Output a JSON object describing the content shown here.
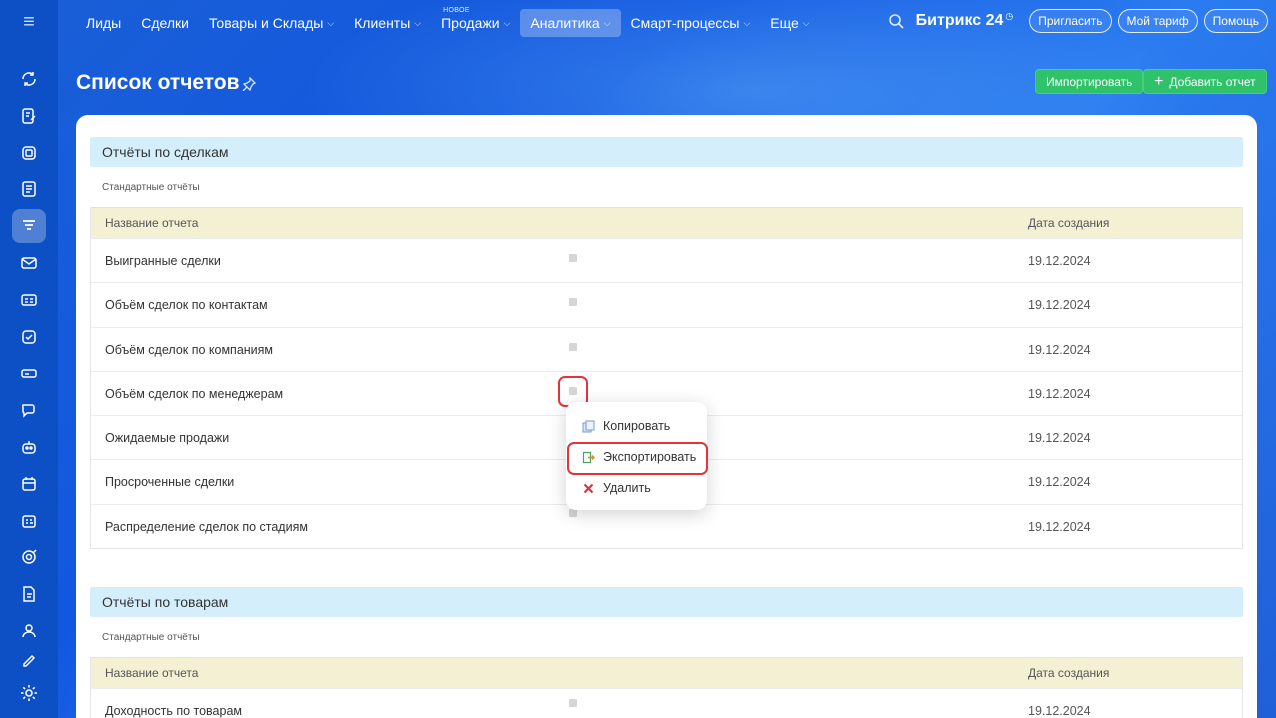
{
  "nav": {
    "items": [
      {
        "label": "Лиды"
      },
      {
        "label": "Сделки"
      },
      {
        "label": "Товары и Склады",
        "dropdown": true
      },
      {
        "label": "Клиенты",
        "dropdown": true
      },
      {
        "label": "Продажи",
        "dropdown": true,
        "badge": "НОВОЕ"
      },
      {
        "label": "Аналитика",
        "dropdown": true,
        "active": true
      },
      {
        "label": "Смарт-процессы",
        "dropdown": true
      },
      {
        "label": "Еще",
        "dropdown": true
      }
    ]
  },
  "header": {
    "brand": "Битрикс",
    "brand_num": "24",
    "invite": "Пригласить",
    "tariff": "Мой тариф",
    "help": "Помощь"
  },
  "page": {
    "title": "Список отчетов",
    "import_label": "Импортировать",
    "add_label": "Добавить отчет"
  },
  "sections": [
    {
      "title": "Отчёты по сделкам",
      "subtitle": "Стандартные отчёты",
      "col_name": "Название отчета",
      "col_date": "Дата создания",
      "rows": [
        {
          "name": "Выигранные сделки",
          "date": "19.12.2024"
        },
        {
          "name": "Объём сделок по контактам",
          "date": "19.12.2024"
        },
        {
          "name": "Объём сделок по компаниям",
          "date": "19.12.2024"
        },
        {
          "name": "Объём сделок по менеджерам",
          "date": "19.12.2024"
        },
        {
          "name": "Ожидаемые продажи",
          "date": "19.12.2024"
        },
        {
          "name": "Просроченные сделки",
          "date": "19.12.2024"
        },
        {
          "name": "Распределение сделок по стадиям",
          "date": "19.12.2024"
        }
      ]
    },
    {
      "title": "Отчёты по товарам",
      "subtitle": "Стандартные отчёты",
      "col_name": "Название отчета",
      "col_date": "Дата создания",
      "rows": [
        {
          "name": "Доходность по товарам",
          "date": "19.12.2024"
        }
      ]
    }
  ],
  "context_menu": {
    "copy": "Копировать",
    "export": "Экспортировать",
    "delete": "Удалить"
  },
  "colors": {
    "accent_green": "#2fc26b",
    "highlight_red": "#e2343f",
    "section_bg": "#d4eefb",
    "thead_bg": "#f3f0d4"
  },
  "sidebar_icons": [
    "sync-icon",
    "edit-doc-icon",
    "box-icon",
    "document-icon",
    "funnel-icon",
    "mail-icon",
    "contact-card-icon",
    "checkbox-icon",
    "drive-icon",
    "chat-icon",
    "robot-icon",
    "calendar-icon",
    "schedule-icon",
    "target-icon",
    "file-icon",
    "users-icon",
    "pen-icon"
  ]
}
